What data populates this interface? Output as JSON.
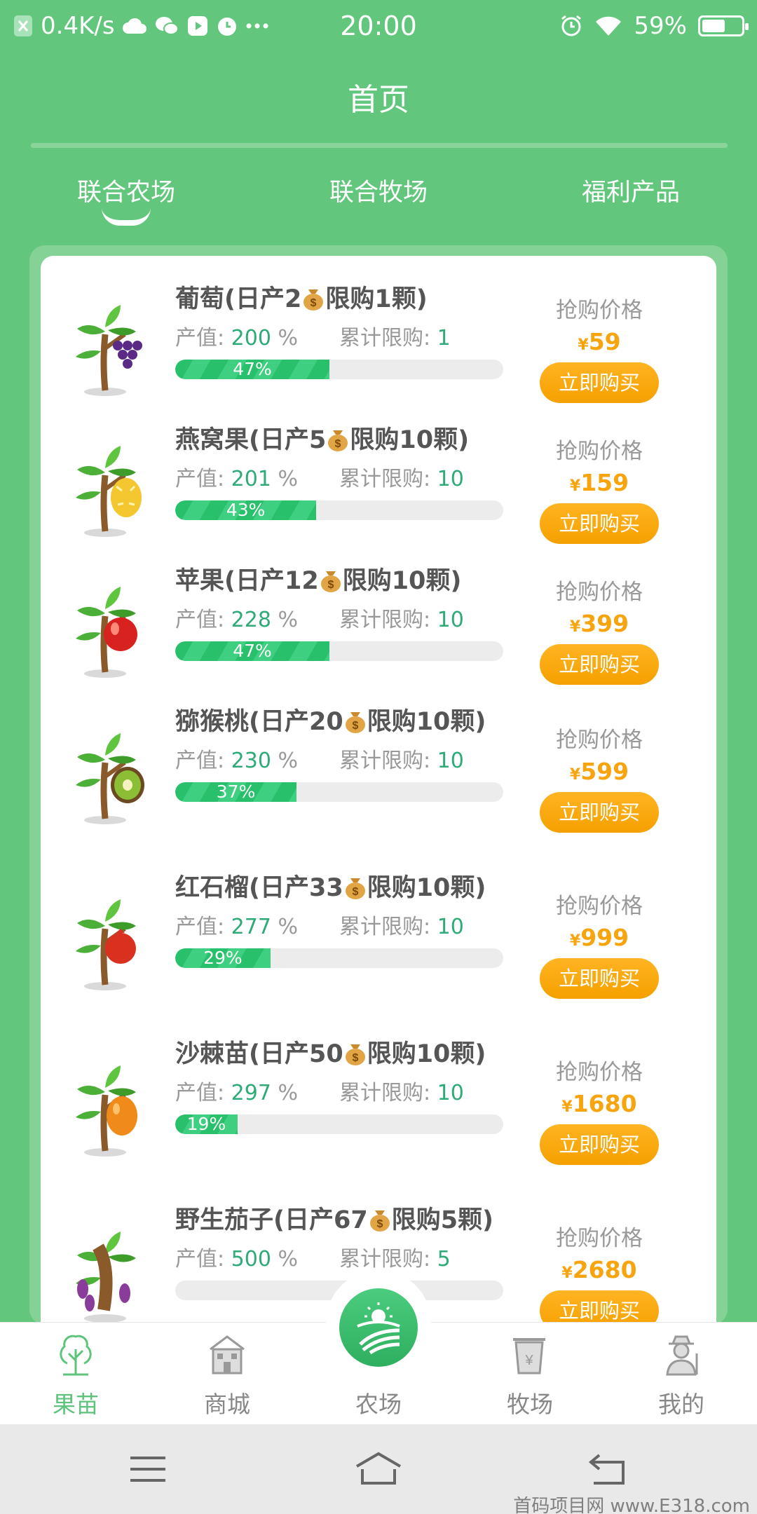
{
  "status_bar": {
    "speed": "0.4K/s",
    "time": "20:00",
    "battery": "59%",
    "battery_level": 0.59
  },
  "header": {
    "title": "首页"
  },
  "tabs": [
    {
      "label": "联合农场",
      "active": true
    },
    {
      "label": "联合牧场",
      "active": false
    },
    {
      "label": "福利产品",
      "active": false
    }
  ],
  "labels": {
    "output_value": "产值:",
    "limit": "累计限购:",
    "price_title": "抢购价格",
    "buy": "立即购买",
    "currency": "¥"
  },
  "items": [
    {
      "name_a": "葡萄(日产2",
      "name_b": "限购1颗)",
      "output": "200",
      "unit": "%",
      "limit": "1",
      "progress_label": "47%",
      "progress": 0.47,
      "price": "59",
      "fruit": "grape",
      "fruit_color": "#5b2a86"
    },
    {
      "name_a": "燕窝果(日产5",
      "name_b": "限购10颗)",
      "output": "201",
      "unit": "%",
      "limit": "10",
      "progress_label": "43%",
      "progress": 0.43,
      "price": "159",
      "fruit": "pitaya",
      "fruit_color": "#f4c62f"
    },
    {
      "name_a": "苹果(日产12",
      "name_b": "限购10颗)",
      "output": "228",
      "unit": "%",
      "limit": "10",
      "progress_label": "47%",
      "progress": 0.47,
      "price": "399",
      "fruit": "apple",
      "fruit_color": "#d8221f"
    },
    {
      "name_a": "猕猴桃(日产20",
      "name_b": "限购10颗)",
      "output": "230",
      "unit": "%",
      "limit": "10",
      "progress_label": "37%",
      "progress": 0.37,
      "price": "599",
      "fruit": "kiwi",
      "fruit_color": "#8bbd35"
    },
    {
      "name_a": "红石榴(日产33",
      "name_b": "限购10颗)",
      "output": "277",
      "unit": "%",
      "limit": "10",
      "progress_label": "29%",
      "progress": 0.29,
      "price": "999",
      "fruit": "pomegranate",
      "fruit_color": "#d9301f"
    },
    {
      "name_a": "沙棘苗(日产50",
      "name_b": "限购10颗)",
      "output": "297",
      "unit": "%",
      "limit": "10",
      "progress_label": "19%",
      "progress": 0.19,
      "price": "1680",
      "fruit": "buckthorn",
      "fruit_color": "#f08a1a"
    },
    {
      "name_a": "野生茄子(日产67",
      "name_b": "限购5颗)",
      "output": "500",
      "unit": "%",
      "limit": "5",
      "progress_label": "",
      "progress": 0,
      "price": "2680",
      "fruit": "eggplant",
      "fruit_color": "#8a3c9a"
    }
  ],
  "bottom_nav": [
    {
      "label": "果苗",
      "icon": "tree-icon",
      "active": true
    },
    {
      "label": "商城",
      "icon": "shop-icon",
      "active": false
    },
    {
      "label": "农场",
      "icon": "farm-icon",
      "active": false
    },
    {
      "label": "牧场",
      "icon": "pasture-icon",
      "active": false
    },
    {
      "label": "我的",
      "icon": "farmer-icon",
      "active": false
    }
  ],
  "watermark": "首码项目网 www.E318.com"
}
